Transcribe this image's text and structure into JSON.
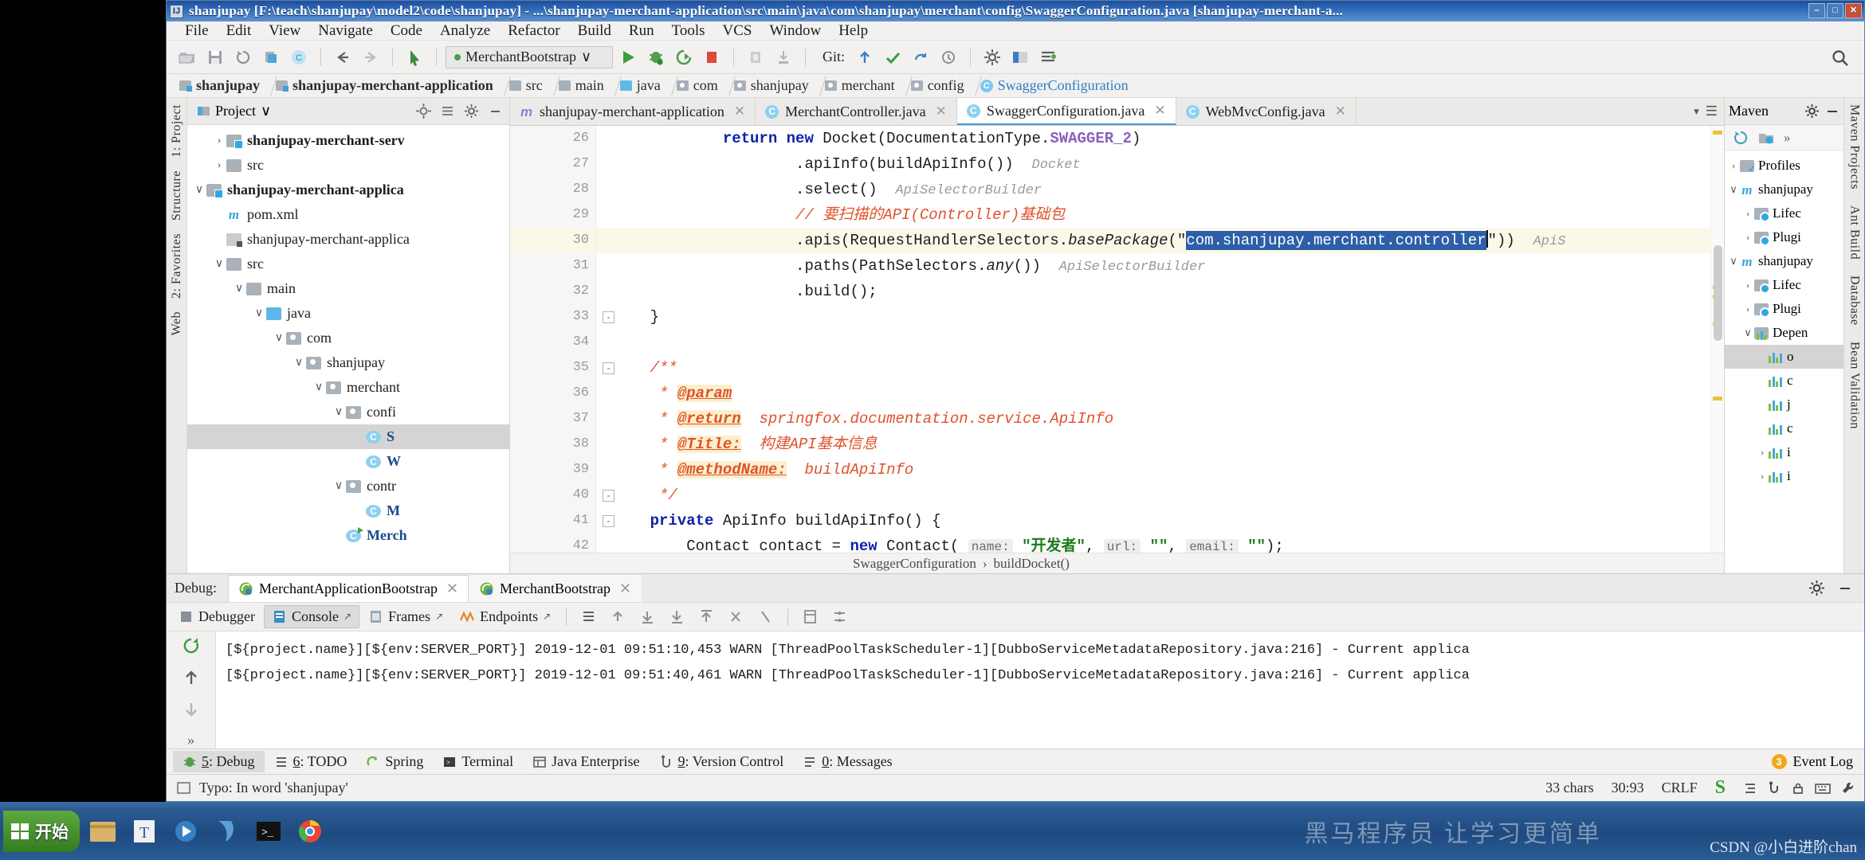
{
  "window": {
    "title": "shanjupay [F:\\teach\\shanjupay\\model2\\code\\shanjupay] - ...\\shanjupay-merchant-application\\src\\main\\java\\com\\shanjupay\\merchant\\config\\SwaggerConfiguration.java [shanjupay-merchant-a...",
    "icon": "idea-icon",
    "minimize": "–",
    "maximize": "□",
    "close": "✕"
  },
  "menu": [
    "File",
    "Edit",
    "View",
    "Navigate",
    "Code",
    "Analyze",
    "Refactor",
    "Build",
    "Run",
    "Tools",
    "VCS",
    "Window",
    "Help"
  ],
  "toolbar": {
    "run_config": "MerchantBootstrap",
    "run_config_caret": "∨",
    "git_label": "Git:",
    "icons": [
      "open-folder-icon",
      "save-all-icon",
      "sync-icon",
      "copy-icon",
      "compile-icon",
      "back-arrow-icon",
      "forward-arrow-icon",
      "pointer-icon",
      "run-icon",
      "debug-icon",
      "run-coverage-icon",
      "stop-icon",
      "profile-icon",
      "attach-icon",
      "git-update-icon",
      "git-commit-icon",
      "git-push-icon",
      "git-history-icon",
      "search-everywhere-icon",
      "settings-icon",
      "project-structure-icon",
      "layout-icon",
      "magnifier-icon"
    ]
  },
  "breadcrumb": [
    {
      "label": "shanjupay",
      "type": "module",
      "bold": true
    },
    {
      "label": "shanjupay-merchant-application",
      "type": "module",
      "bold": true
    },
    {
      "label": "src",
      "type": "folder",
      "bold": false
    },
    {
      "label": "main",
      "type": "folder",
      "bold": false
    },
    {
      "label": "java",
      "type": "source-folder",
      "bold": false
    },
    {
      "label": "com",
      "type": "package",
      "bold": false
    },
    {
      "label": "shanjupay",
      "type": "package",
      "bold": false
    },
    {
      "label": "merchant",
      "type": "package",
      "bold": false
    },
    {
      "label": "config",
      "type": "package",
      "bold": false
    },
    {
      "label": "SwaggerConfiguration",
      "type": "class",
      "bold": false
    }
  ],
  "project_panel": {
    "title": "Project",
    "caret": "∨",
    "buttons": [
      "locate-icon",
      "collapse-all-icon",
      "settings-icon",
      "hide-icon"
    ],
    "tree": [
      {
        "indent": 1,
        "arrow": "›",
        "icon": "module",
        "label": "shanjupay-merchant-serv",
        "bold": true,
        "selected": false
      },
      {
        "indent": 1,
        "arrow": "›",
        "icon": "folder",
        "label": "src",
        "bold": false,
        "selected": false
      },
      {
        "indent": 0,
        "arrow": "∨",
        "icon": "module",
        "label": "shanjupay-merchant-applica",
        "bold": true,
        "selected": false
      },
      {
        "indent": 1,
        "arrow": "",
        "icon": "maven",
        "label": "pom.xml",
        "bold": false,
        "selected": false
      },
      {
        "indent": 1,
        "arrow": "",
        "icon": "file",
        "label": "shanjupay-merchant-applica",
        "bold": false,
        "selected": false
      },
      {
        "indent": 1,
        "arrow": "∨",
        "icon": "folder",
        "label": "src",
        "bold": false,
        "selected": false
      },
      {
        "indent": 2,
        "arrow": "∨",
        "icon": "folder",
        "label": "main",
        "bold": false,
        "selected": false
      },
      {
        "indent": 3,
        "arrow": "∨",
        "icon": "folder-blue",
        "label": "java",
        "bold": false,
        "selected": false
      },
      {
        "indent": 4,
        "arrow": "∨",
        "icon": "package",
        "label": "com",
        "bold": false,
        "selected": false
      },
      {
        "indent": 5,
        "arrow": "∨",
        "icon": "package",
        "label": "shanjupay",
        "bold": false,
        "selected": false
      },
      {
        "indent": 6,
        "arrow": "∨",
        "icon": "package",
        "label": "merchant",
        "bold": false,
        "selected": false
      },
      {
        "indent": 7,
        "arrow": "∨",
        "icon": "package",
        "label": "confi",
        "bold": false,
        "selected": false
      },
      {
        "indent": 8,
        "arrow": "",
        "icon": "class",
        "label": "S",
        "bold": true,
        "selected": true
      },
      {
        "indent": 8,
        "arrow": "",
        "icon": "class",
        "label": "W",
        "bold": true,
        "selected": false
      },
      {
        "indent": 7,
        "arrow": "∨",
        "icon": "package",
        "label": "contr",
        "bold": false,
        "selected": false
      },
      {
        "indent": 8,
        "arrow": "",
        "icon": "class",
        "label": "M",
        "bold": true,
        "selected": false
      },
      {
        "indent": 7,
        "arrow": "",
        "icon": "class-run",
        "label": "Merch",
        "bold": true,
        "selected": false
      }
    ]
  },
  "left_strip": [
    "1: Project",
    "Structure",
    "2: Favorites",
    "Web"
  ],
  "editor_tabs": [
    {
      "label": "shanjupay-merchant-application",
      "icon": "maven-icon",
      "active": false,
      "close": "✕"
    },
    {
      "label": "MerchantController.java",
      "icon": "class-icon",
      "active": false,
      "close": "✕"
    },
    {
      "label": "SwaggerConfiguration.java",
      "icon": "class-icon",
      "active": true,
      "close": "✕"
    },
    {
      "label": "WebMvcConfig.java",
      "icon": "class-icon",
      "active": false,
      "close": "✕"
    }
  ],
  "editor": {
    "first_line": 26,
    "current_line": 30,
    "lines": [
      {
        "n": 26,
        "fold": "",
        "segments": [
          {
            "t": "            ",
            "c": "plain"
          },
          {
            "t": "return",
            "c": "kw"
          },
          {
            "t": " ",
            "c": "plain"
          },
          {
            "t": "new",
            "c": "kw"
          },
          {
            "t": " Docket(DocumentationType.",
            "c": "plain"
          },
          {
            "t": "SWAGGER_2",
            "c": "statfield"
          },
          {
            "t": ")",
            "c": "plain"
          }
        ]
      },
      {
        "n": 27,
        "fold": "",
        "segments": [
          {
            "t": "                    .apiInfo(buildApiInfo())  ",
            "c": "plain"
          },
          {
            "t": "Docket",
            "c": "hint"
          }
        ]
      },
      {
        "n": 28,
        "fold": "",
        "segments": [
          {
            "t": "                    .select()  ",
            "c": "plain"
          },
          {
            "t": "ApiSelectorBuilder",
            "c": "hint"
          }
        ]
      },
      {
        "n": 29,
        "fold": "",
        "segments": [
          {
            "t": "                    // 要扫描的API(Controller)基础包",
            "c": "cm"
          }
        ]
      },
      {
        "n": 30,
        "fold": "",
        "current": true,
        "segments": [
          {
            "t": "                    .apis(RequestHandlerSelectors.",
            "c": "plain"
          },
          {
            "t": "basePackage",
            "c": "it"
          },
          {
            "t": "(\"",
            "c": "plain"
          },
          {
            "t": "com.shanjupay.merchant.controller",
            "c": "sel"
          },
          {
            "t": "\"))  ",
            "c": "plain"
          },
          {
            "t": "ApiS",
            "c": "hint"
          }
        ]
      },
      {
        "n": 31,
        "fold": "",
        "segments": [
          {
            "t": "                    .paths(PathSelectors.",
            "c": "plain"
          },
          {
            "t": "any",
            "c": "it"
          },
          {
            "t": "())  ",
            "c": "plain"
          },
          {
            "t": "ApiSelectorBuilder",
            "c": "hint"
          }
        ]
      },
      {
        "n": 32,
        "fold": "",
        "segments": [
          {
            "t": "                    .build();",
            "c": "plain"
          }
        ]
      },
      {
        "n": 33,
        "fold": "-",
        "segments": [
          {
            "t": "    }",
            "c": "plain"
          }
        ]
      },
      {
        "n": 34,
        "fold": "",
        "segments": [
          {
            "t": "",
            "c": "plain"
          }
        ]
      },
      {
        "n": 35,
        "fold": "-",
        "segments": [
          {
            "t": "    /**",
            "c": "cm"
          }
        ]
      },
      {
        "n": 36,
        "fold": "",
        "segments": [
          {
            "t": "     * ",
            "c": "cm"
          },
          {
            "t": "@param",
            "c": "cmtag"
          }
        ]
      },
      {
        "n": 37,
        "fold": "",
        "segments": [
          {
            "t": "     * ",
            "c": "cm"
          },
          {
            "t": "@return",
            "c": "cmtag"
          },
          {
            "t": "  springfox.documentation.service.ApiInfo",
            "c": "cmtag2"
          }
        ]
      },
      {
        "n": 38,
        "fold": "",
        "segments": [
          {
            "t": "     * ",
            "c": "cm"
          },
          {
            "t": "@Title:",
            "c": "cmtag"
          },
          {
            "t": "  构建API基本信息",
            "c": "cmtag2"
          }
        ]
      },
      {
        "n": 39,
        "fold": "",
        "segments": [
          {
            "t": "     * ",
            "c": "cm"
          },
          {
            "t": "@methodName:",
            "c": "cmtag"
          },
          {
            "t": "  buildApiInfo",
            "c": "cmtag2"
          }
        ]
      },
      {
        "n": 40,
        "fold": "-",
        "segments": [
          {
            "t": "     */",
            "c": "cm"
          }
        ]
      },
      {
        "n": 41,
        "fold": "-",
        "segments": [
          {
            "t": "    ",
            "c": "plain"
          },
          {
            "t": "private",
            "c": "kw"
          },
          {
            "t": " ApiInfo buildApiInfo() {",
            "c": "plain"
          }
        ]
      },
      {
        "n": 42,
        "fold": "",
        "segments": [
          {
            "t": "        Contact contact = ",
            "c": "plain"
          },
          {
            "t": "new",
            "c": "kw"
          },
          {
            "t": " Contact( ",
            "c": "plain"
          },
          {
            "t": "name:",
            "c": "hintbox"
          },
          {
            "t": " ",
            "c": "plain"
          },
          {
            "t": "\"开发者\"",
            "c": "str"
          },
          {
            "t": ", ",
            "c": "plain"
          },
          {
            "t": "url:",
            "c": "hintbox"
          },
          {
            "t": " ",
            "c": "plain"
          },
          {
            "t": "\"\"",
            "c": "str"
          },
          {
            "t": ", ",
            "c": "plain"
          },
          {
            "t": "email:",
            "c": "hintbox"
          },
          {
            "t": " ",
            "c": "plain"
          },
          {
            "t": "\"\"",
            "c": "str"
          },
          {
            "t": ");",
            "c": "plain"
          }
        ]
      }
    ],
    "selection_text": "com.shanjupay.merchant.controller",
    "footer_breadcrumb": [
      "SwaggerConfiguration",
      "buildDocket()"
    ],
    "footer_separator": "›"
  },
  "maven_panel": {
    "title": "Maven",
    "buttons": [
      "settings-icon",
      "hide-icon"
    ],
    "toolbar_icons": [
      "reimport-icon",
      "download-sources-icon",
      "more-icon"
    ],
    "tree": [
      {
        "indent": 0,
        "arrow": "›",
        "icon": "profiles",
        "label": "Profiles",
        "selected": false
      },
      {
        "indent": 0,
        "arrow": "∨",
        "icon": "maven-module",
        "label": "shanjupay",
        "selected": false
      },
      {
        "indent": 1,
        "arrow": "›",
        "icon": "gear-folder",
        "label": "Lifec",
        "selected": false
      },
      {
        "indent": 1,
        "arrow": "›",
        "icon": "gear-folder",
        "label": "Plugi",
        "selected": false
      },
      {
        "indent": 0,
        "arrow": "∨",
        "icon": "maven-module",
        "label": "shanjupay",
        "selected": false
      },
      {
        "indent": 1,
        "arrow": "›",
        "icon": "gear-folder",
        "label": "Lifec",
        "selected": false
      },
      {
        "indent": 1,
        "arrow": "›",
        "icon": "gear-folder",
        "label": "Plugi",
        "selected": false
      },
      {
        "indent": 1,
        "arrow": "∨",
        "icon": "dep-folder",
        "label": "Depen",
        "selected": false
      },
      {
        "indent": 2,
        "arrow": "",
        "icon": "dep",
        "label": "o",
        "selected": true
      },
      {
        "indent": 2,
        "arrow": "",
        "icon": "dep",
        "label": "c",
        "selected": false
      },
      {
        "indent": 2,
        "arrow": "",
        "icon": "dep",
        "label": "j",
        "selected": false
      },
      {
        "indent": 2,
        "arrow": "",
        "icon": "dep",
        "label": "c",
        "selected": false
      },
      {
        "indent": 2,
        "arrow": "›",
        "icon": "dep",
        "label": "i",
        "selected": false
      },
      {
        "indent": 2,
        "arrow": "›",
        "icon": "dep",
        "label": "i",
        "selected": false
      }
    ]
  },
  "right_strip": [
    "Maven Projects",
    "Ant Build",
    "Database",
    "Bean Validation"
  ],
  "debug_panel": {
    "label": "Debug:",
    "tabs": [
      {
        "label": "MerchantApplicationBootstrap",
        "active": true,
        "close": "✕"
      },
      {
        "label": "MerchantBootstrap",
        "active": false,
        "close": "✕"
      }
    ],
    "header_icons": [
      "settings-icon",
      "hide-icon"
    ],
    "console_tabs": [
      {
        "label": "Debugger",
        "active": false,
        "pin": ""
      },
      {
        "label": "Console",
        "active": true,
        "pin": "↗"
      },
      {
        "label": "Frames",
        "active": false,
        "pin": "↗"
      },
      {
        "label": "Endpoints",
        "active": false,
        "pin": "↗"
      }
    ],
    "console_toolbar_icons": [
      "show-lines-icon",
      "step-out-icon",
      "step-into-icon",
      "step-over-icon",
      "step-up-icon",
      "mute-breakpoints-icon",
      "resume-icon",
      "evaluate-icon",
      "settings2-icon"
    ],
    "left_icons": [
      "rerun-icon",
      "scroll-up-icon",
      "scroll-down-icon",
      "more-icon"
    ],
    "log_lines": [
      "[${project.name}][${env:SERVER_PORT}] 2019-12-01 09:51:10,453 WARN [ThreadPoolTaskScheduler-1][DubboServiceMetadataRepository.java:216] - Current applica",
      "[${project.name}][${env:SERVER_PORT}] 2019-12-01 09:51:40,461 WARN [ThreadPoolTaskScheduler-1][DubboServiceMetadataRepository.java:216] - Current applica"
    ]
  },
  "tool_windows": [
    {
      "num": "5",
      "label": "Debug",
      "icon": "debug-icon",
      "active": true
    },
    {
      "num": "6",
      "label": "TODO",
      "icon": "todo-icon",
      "active": false
    },
    {
      "num": "",
      "label": "Spring",
      "icon": "spring-icon",
      "active": false
    },
    {
      "num": "",
      "label": "Terminal",
      "icon": "terminal-icon",
      "active": false
    },
    {
      "num": "",
      "label": "Java Enterprise",
      "icon": "jee-icon",
      "active": false
    },
    {
      "num": "9",
      "label": "Version Control",
      "icon": "vcs-icon",
      "active": false
    },
    {
      "num": "0",
      "label": "Messages",
      "icon": "messages-icon",
      "active": false
    }
  ],
  "event_log": {
    "count": "3",
    "label": "Event Log"
  },
  "status_bar": {
    "message": "Typo: In word 'shanjupay'",
    "chars": "33 chars",
    "position": "30:93",
    "line_sep": "CRLF",
    "encoding": "S",
    "icons": [
      "encoding-icon",
      "indent-icon",
      "git-branch-icon",
      "lock-icon",
      "keyboard-icon",
      "wrench-icon"
    ]
  },
  "taskbar": {
    "start": "开始",
    "items": [
      "files-icon",
      "text-editor-icon",
      "media-icon",
      "browser-icon",
      "terminal-icon",
      "chrome-icon"
    ],
    "watermark": "黑马程序员 让学习更简单",
    "credit": "CSDN @小白进阶chan"
  }
}
